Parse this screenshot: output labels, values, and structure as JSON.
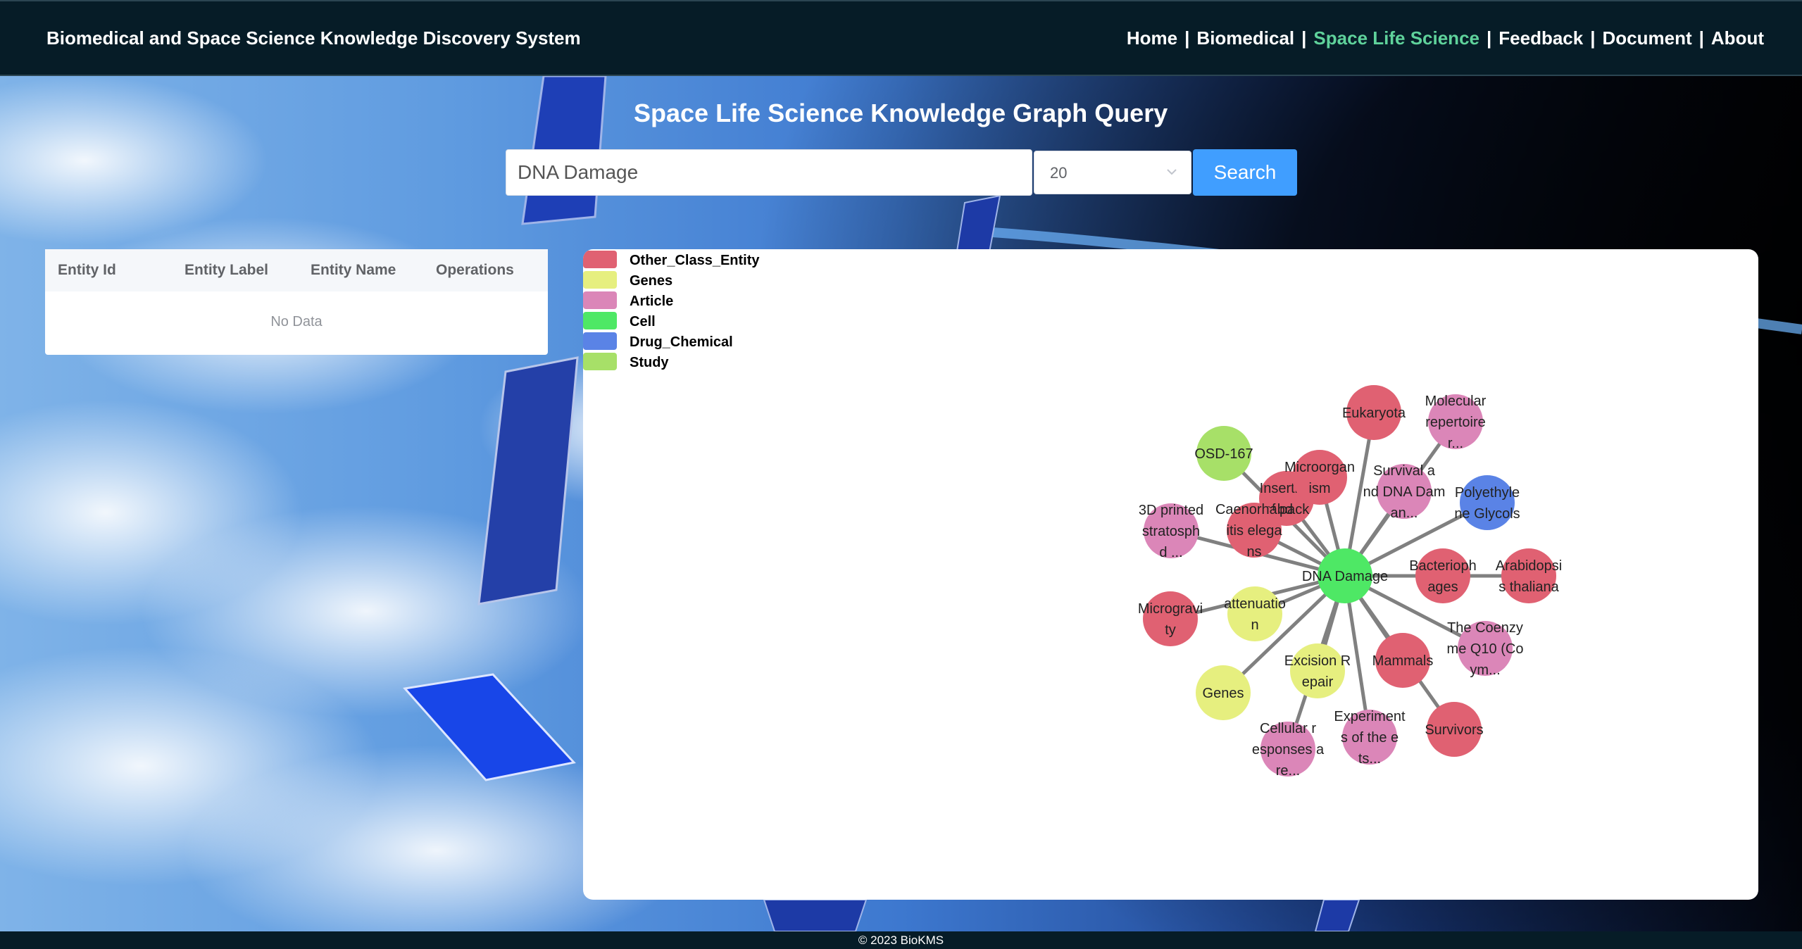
{
  "header": {
    "brand": "Biomedical and Space Science Knowledge Discovery System",
    "nav": [
      {
        "label": "Home",
        "active": false
      },
      {
        "label": "Biomedical",
        "active": false
      },
      {
        "label": "Space Life Science",
        "active": true
      },
      {
        "label": "Feedback",
        "active": false
      },
      {
        "label": "Document",
        "active": false
      },
      {
        "label": "About",
        "active": false
      }
    ],
    "separator": "|",
    "active_color": "#5fd29b"
  },
  "page_title": "Space Life Science Knowledge Graph Query",
  "search": {
    "value": "DNA Damage",
    "limit": "20",
    "button_label": "Search",
    "button_color": "#409eff"
  },
  "table": {
    "columns": [
      "Entity Id",
      "Entity Label",
      "Entity Name",
      "Operations"
    ],
    "empty_text": "No Data"
  },
  "legend": [
    {
      "name": "Other_Class_Entity",
      "color": "#e06172"
    },
    {
      "name": "Genes",
      "color": "#e6ef7f"
    },
    {
      "name": "Article",
      "color": "#db86b8"
    },
    {
      "name": "Cell",
      "color": "#4ee865"
    },
    {
      "name": "Drug_Chemical",
      "color": "#5a83e6"
    },
    {
      "name": "Study",
      "color": "#a7e068"
    }
  ],
  "graph": {
    "center": {
      "id": "center",
      "lines": [
        "DNA Damage"
      ],
      "category": "Cell"
    },
    "nodes": [
      {
        "id": "insertion",
        "lines": [
          "Insertion",
          "of pack"
        ],
        "category": "Other_Class_Entity"
      },
      {
        "id": "eukaryota",
        "lines": [
          "Eukaryota"
        ],
        "category": "Other_Class_Entity"
      },
      {
        "id": "molecular",
        "lines": [
          "Molecular",
          "repertoire",
          "r..."
        ],
        "category": "Article"
      },
      {
        "id": "osd167",
        "lines": [
          "OSD-167"
        ],
        "category": "Study"
      },
      {
        "id": "microorganism",
        "lines": [
          "Microorgan",
          "ism"
        ],
        "category": "Other_Class_Entity"
      },
      {
        "id": "survival",
        "lines": [
          "Survival a",
          "nd DNA Dam",
          "an..."
        ],
        "category": "Article"
      },
      {
        "id": "polyethylene",
        "lines": [
          "Polyethyle",
          "ne Glycols"
        ],
        "category": "Drug_Chemical"
      },
      {
        "id": "3dprinted",
        "lines": [
          "3D printed",
          "stratosph",
          "d ..."
        ],
        "category": "Article"
      },
      {
        "id": "celegans",
        "lines": [
          "Caenorhabd",
          "itis elega",
          "ns"
        ],
        "category": "Other_Class_Entity"
      },
      {
        "id": "bacteriophages",
        "lines": [
          "Bacterioph",
          "ages"
        ],
        "category": "Other_Class_Entity"
      },
      {
        "id": "arabidopsis",
        "lines": [
          "Arabidopsi",
          "s thaliana"
        ],
        "category": "Other_Class_Entity"
      },
      {
        "id": "microgravity",
        "lines": [
          "Microgravi",
          "ty"
        ],
        "category": "Other_Class_Entity"
      },
      {
        "id": "attenuation",
        "lines": [
          "attenuatio",
          "n"
        ],
        "category": "Genes"
      },
      {
        "id": "coenzyme",
        "lines": [
          "The Coenzy",
          "me Q10 (Co",
          "ym..."
        ],
        "category": "Article"
      },
      {
        "id": "excision",
        "lines": [
          "Excision R",
          "epair"
        ],
        "category": "Genes"
      },
      {
        "id": "mammals",
        "lines": [
          "Mammals"
        ],
        "category": "Other_Class_Entity"
      },
      {
        "id": "genes",
        "lines": [
          "Genes"
        ],
        "category": "Genes"
      },
      {
        "id": "survivors",
        "lines": [
          "Survivors"
        ],
        "category": "Other_Class_Entity"
      },
      {
        "id": "cellular",
        "lines": [
          "Cellular r",
          "esponses a",
          "re..."
        ],
        "category": "Article"
      },
      {
        "id": "experiments",
        "lines": [
          "Experiment",
          "s of the e",
          "ts..."
        ],
        "category": "Article"
      }
    ]
  },
  "footer": "© 2023 BioKMS"
}
